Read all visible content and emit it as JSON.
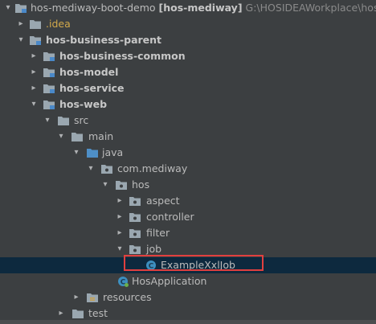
{
  "project": {
    "name": "hos-mediway-boot-demo",
    "module": "[hos-mediway]",
    "path": "G:\\HOSIDEAWorkplace\\hos-m"
  },
  "tree": {
    "idea": ".idea",
    "business_parent": "hos-business-parent",
    "business_common": "hos-business-common",
    "model": "hos-model",
    "service": "hos-service",
    "web": "hos-web",
    "src": "src",
    "main": "main",
    "java": "java",
    "package": "com.mediway",
    "hos": "hos",
    "aspect": "aspect",
    "controller": "controller",
    "filter": "filter",
    "job": "job",
    "example_class": "ExampleXxlJob",
    "app_class": "HosApplication",
    "resources": "resources",
    "test": "test"
  },
  "icons": {
    "folder": "folder-icon",
    "module": "module-icon",
    "source": "source-folder-icon",
    "package": "package-icon",
    "class": "class-icon",
    "spring_class": "spring-app-icon",
    "resources": "resources-folder-icon"
  },
  "colors": {
    "background": "#3c3f41",
    "selection": "#0d293e",
    "highlight": "#e0403f",
    "folder": "#9aa7b0",
    "source_folder": "#4e8fc7",
    "class_icon": "#3d8fbf"
  }
}
